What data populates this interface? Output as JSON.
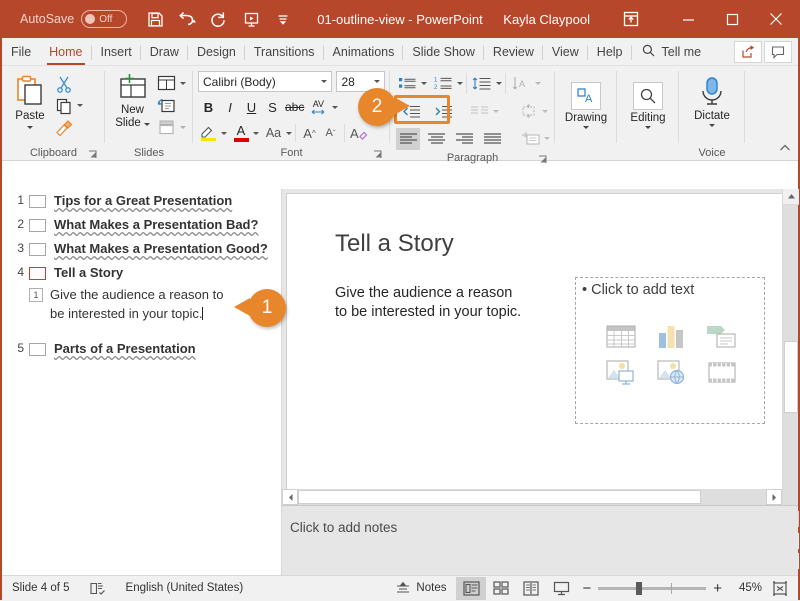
{
  "titlebar": {
    "autosave_label": "AutoSave",
    "autosave_state": "Off",
    "doc_title": "01-outline-view",
    "app_name": "PowerPoint",
    "title_full": "01-outline-view  -  PowerPoint",
    "account_name": "Kayla Claypool",
    "quick_access": [
      {
        "name": "save-icon",
        "tip": "Save"
      },
      {
        "name": "undo-icon",
        "tip": "Undo"
      },
      {
        "name": "redo-icon",
        "tip": "Redo"
      },
      {
        "name": "start-slideshow-icon",
        "tip": "Start From Beginning"
      },
      {
        "name": "customize-qat-icon",
        "tip": "Customize Quick Access Toolbar"
      }
    ],
    "window_controls": [
      {
        "name": "ribbon-display-options-icon",
        "glyph": "ribbon"
      },
      {
        "name": "minimize-button",
        "glyph": "minimize"
      },
      {
        "name": "restore-button",
        "glyph": "restore"
      },
      {
        "name": "close-button",
        "glyph": "close"
      }
    ]
  },
  "tabs": [
    {
      "label": "File"
    },
    {
      "label": "Home"
    },
    {
      "label": "Insert"
    },
    {
      "label": "Draw"
    },
    {
      "label": "Design"
    },
    {
      "label": "Transitions"
    },
    {
      "label": "Animations"
    },
    {
      "label": "Slide Show"
    },
    {
      "label": "Review"
    },
    {
      "label": "View"
    },
    {
      "label": "Help"
    }
  ],
  "active_tab": "Home",
  "tellme": {
    "label": "Tell me"
  },
  "tabbar_right": [
    {
      "name": "share-button",
      "tip": "Share"
    },
    {
      "name": "comments-button",
      "tip": "Comments"
    }
  ],
  "ribbon": {
    "groups": [
      {
        "name": "Clipboard",
        "buttons": [
          {
            "label": "Paste",
            "name": "paste-button"
          },
          {
            "label": "Cut",
            "name": "cut-button"
          },
          {
            "label": "Copy",
            "name": "copy-button"
          },
          {
            "label": "Format Painter",
            "name": "format-painter-button"
          }
        ]
      },
      {
        "name": "Slides",
        "buttons": [
          {
            "label": "New\nSlide",
            "name": "new-slide-button"
          },
          {
            "label": "Layout",
            "name": "layout-button"
          },
          {
            "label": "Reset",
            "name": "reset-button"
          },
          {
            "label": "Section",
            "name": "section-button"
          }
        ]
      },
      {
        "name": "Font",
        "font_name": "Calibri (Body)",
        "font_size": "28",
        "buttons": [
          {
            "label": "B",
            "name": "bold-button"
          },
          {
            "label": "I",
            "name": "italic-button"
          },
          {
            "label": "U",
            "name": "underline-button"
          },
          {
            "label": "S",
            "name": "text-shadow-button"
          },
          {
            "label": "abc",
            "name": "strikethrough-button"
          },
          {
            "label": "AV",
            "name": "character-spacing-button"
          },
          {
            "label": "Aa",
            "name": "change-case-button"
          },
          {
            "label": "A",
            "name": "increase-font-size-button"
          },
          {
            "label": "A",
            "name": "decrease-font-size-button"
          },
          {
            "label": "A",
            "name": "clear-formatting-button"
          }
        ]
      },
      {
        "name": "Paragraph",
        "buttons": [
          {
            "label": "Bullets",
            "name": "bullets-button"
          },
          {
            "label": "Numbering",
            "name": "numbering-button"
          },
          {
            "label": "Line Spacing",
            "name": "line-spacing-button"
          },
          {
            "label": "Text Direction",
            "name": "text-direction-button"
          },
          {
            "label": "Decrease List Level",
            "name": "decrease-indent-button"
          },
          {
            "label": "Increase List Level",
            "name": "increase-indent-button"
          },
          {
            "label": "Columns",
            "name": "columns-button"
          },
          {
            "label": "Align Text",
            "name": "align-text-button"
          },
          {
            "label": "Align Left",
            "name": "align-left-button"
          },
          {
            "label": "Center",
            "name": "align-center-button"
          },
          {
            "label": "Align Right",
            "name": "align-right-button"
          },
          {
            "label": "Justify",
            "name": "justify-button"
          },
          {
            "label": "Convert to SmartArt",
            "name": "smartart-button"
          }
        ]
      },
      {
        "name": "Drawing",
        "label": "Drawing"
      },
      {
        "name": "Editing",
        "label": "Editing"
      },
      {
        "name": "Voice",
        "label": "Dictate"
      }
    ],
    "drawing_label": "Drawing",
    "editing_label": "Editing",
    "dictate_label": "Dictate",
    "voice_group_label": "Voice",
    "collapse_ribbon": "collapse-ribbon-button"
  },
  "callouts": [
    {
      "number": "1",
      "direction": "left"
    },
    {
      "number": "2",
      "direction": "right"
    }
  ],
  "outline": {
    "slides": [
      {
        "num": "1",
        "title": "Tips for a Great Presentation",
        "selected": false,
        "bullets": []
      },
      {
        "num": "2",
        "title": "What Makes a Presentation Bad?",
        "selected": false,
        "bullets": []
      },
      {
        "num": "3",
        "title": "What Makes a Presentation Good?",
        "selected": false,
        "bullets": []
      },
      {
        "num": "4",
        "title": "Tell a Story",
        "selected": true,
        "bullets": [
          {
            "marker": "1",
            "text": "Give the audience a reason to be interested in your topic."
          }
        ]
      },
      {
        "num": "5",
        "title": "Parts of a Presentation",
        "selected": false,
        "bullets": []
      }
    ]
  },
  "slide": {
    "title": "Tell a Story",
    "body_text": "Give the audience a reason to be interested in your topic.",
    "placeholder_text": "Click to add text",
    "placeholder_bullet": "•",
    "content_icons": [
      {
        "name": "insert-table-icon"
      },
      {
        "name": "insert-chart-icon"
      },
      {
        "name": "insert-smartart-icon"
      },
      {
        "name": "insert-3d-model-icon"
      },
      {
        "name": "insert-online-picture-icon"
      },
      {
        "name": "insert-video-icon"
      }
    ]
  },
  "notes": {
    "placeholder": "Click to add notes"
  },
  "status": {
    "slide_indicator": "Slide 4 of 5",
    "accessibility_icon": "accessibility-checker-icon",
    "language": "English (United States)",
    "notes_label": "Notes",
    "zoom_percent": "45%",
    "zoom_minus": "−",
    "zoom_plus": "+",
    "views": [
      {
        "name": "normal-view-button",
        "selected": true
      },
      {
        "name": "slide-sorter-view-button",
        "selected": false
      },
      {
        "name": "reading-view-button",
        "selected": false
      },
      {
        "name": "slide-show-view-button",
        "selected": false
      }
    ],
    "fit_slide": "fit-slide-to-window-button"
  },
  "colors": {
    "accent": "#b7472a",
    "callout": "#e8862c",
    "highlight": "#e8862c"
  }
}
